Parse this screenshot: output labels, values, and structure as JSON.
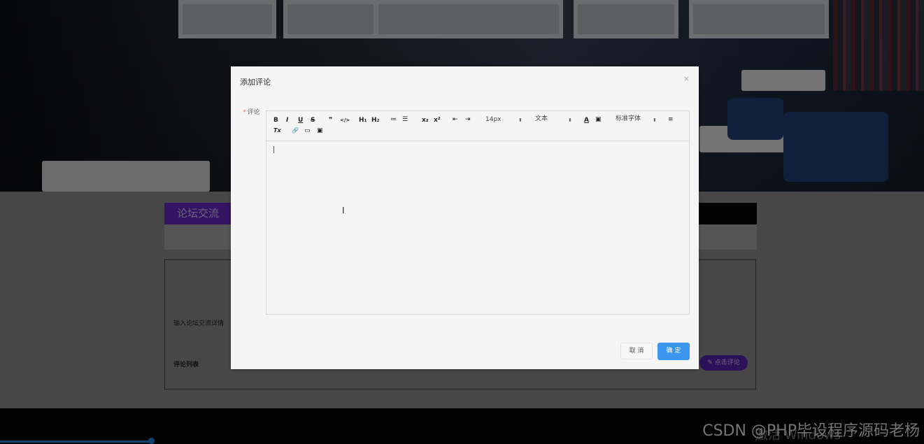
{
  "page": {
    "forum_tab": "论坛交流",
    "detail_label": "输入论坛交流详情",
    "comment_list_label": "评论列表",
    "comment_button": "点击评论"
  },
  "dialog": {
    "title": "添加评论",
    "close": "×",
    "field_required_mark": "*",
    "field_label": "评论",
    "cancel_label": "取 消",
    "ok_label": "确 定"
  },
  "toolbar": {
    "bold": "B",
    "italic": "I",
    "underline": "U",
    "strike": "S",
    "blockquote": "❞",
    "code": "</>",
    "h1": "H₁",
    "h2": "H₂",
    "ordered_list": "≔",
    "bullet_list": "☰",
    "sub": "x₂",
    "sup": "x²",
    "outdent": "⇤",
    "indent": "⇥",
    "size_value": "14px",
    "header_value": "文本",
    "color": "A",
    "background": "▣",
    "font_value": "标准字体",
    "align": "≡",
    "clean": "Tx",
    "link": "🔗",
    "image": "▭",
    "video": "▣",
    "select_arrow": "⬍"
  },
  "footer": {
    "watermark": "CSDN @PHP毕设程序源码老杨",
    "faded": "激活 Windows"
  },
  "colors": {
    "purple": "#6a27c9",
    "primary": "#3a96f0",
    "required": "#f56c6c"
  }
}
